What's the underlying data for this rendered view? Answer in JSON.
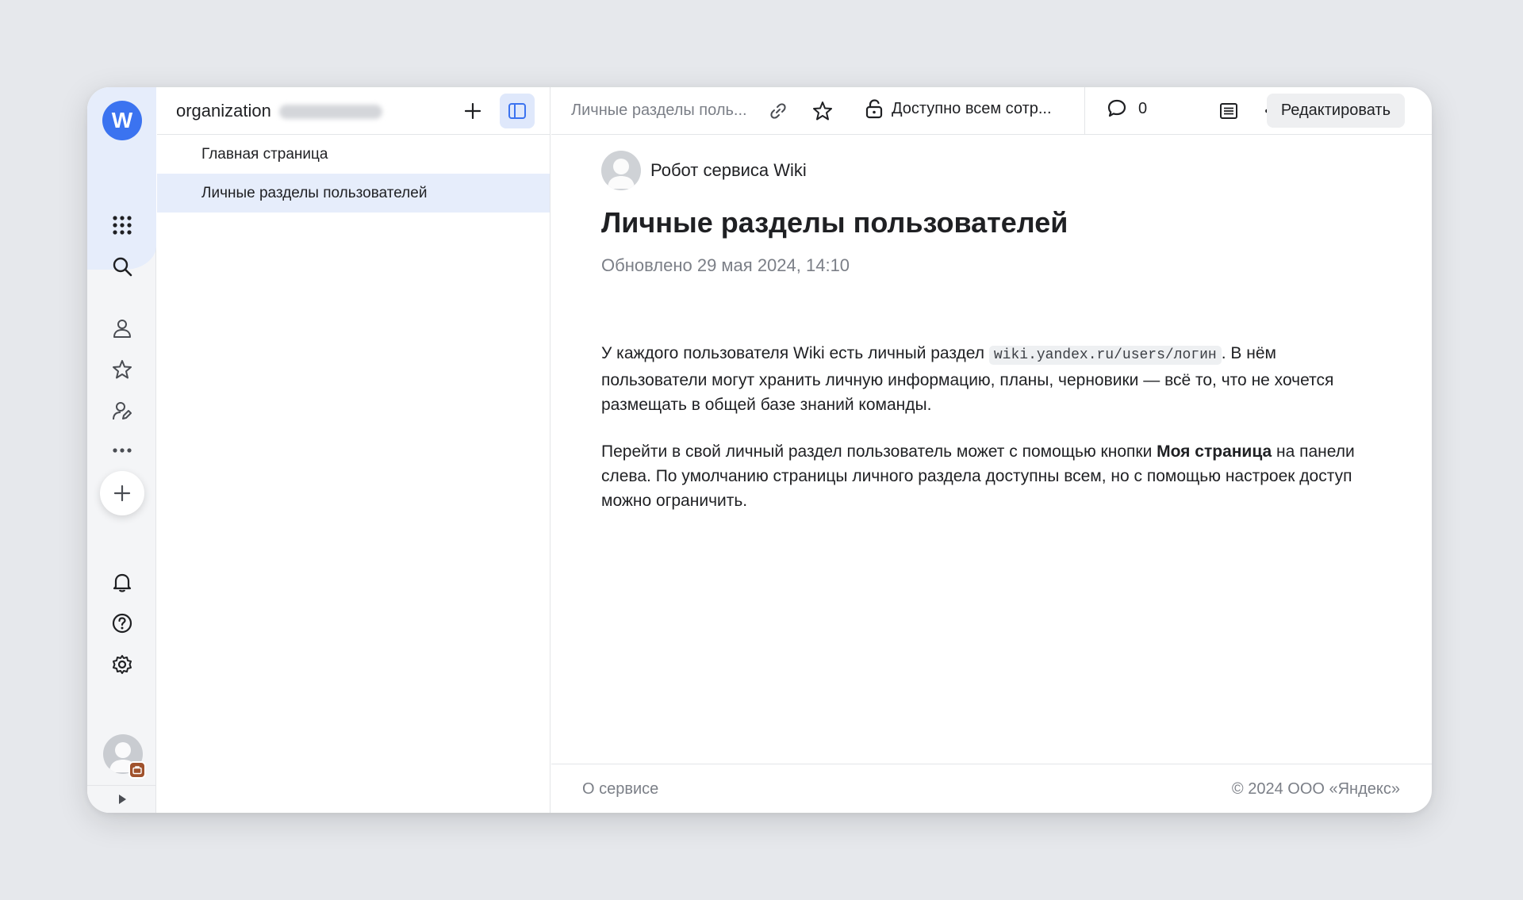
{
  "rail": {
    "logo_letter": "W",
    "icons": [
      "apps-icon",
      "search-icon",
      "user-icon",
      "star-icon",
      "user-edit-icon",
      "more-icon",
      "plus-icon",
      "bell-icon",
      "help-icon",
      "gear-icon"
    ]
  },
  "nav": {
    "org_label": "organization",
    "items": [
      {
        "label": "Главная страница",
        "active": false
      },
      {
        "label": "Личные разделы пользователей",
        "active": true
      }
    ]
  },
  "topbar": {
    "breadcrumb": "Личные разделы поль...",
    "access_label": "Доступно всем сотр...",
    "comments_count": "0",
    "edit_label": "Редактировать"
  },
  "page": {
    "author": "Робот сервиса Wiki",
    "title": "Личные разделы пользователей",
    "updated": "Обновлено 29 мая 2024,  14:10",
    "p1_before": "У каждого пользователя Wiki есть личный раздел ",
    "p1_code": "wiki.yandex.ru/users/логин",
    "p1_after": ". В нём пользователи могут хранить личную информацию, планы, черновики — всё то, что не хочется размещать в общей базе знаний команды.",
    "p2_before": "Перейти в свой личный раздел пользователь может с помощью кнопки ",
    "p2_bold": "Моя страница",
    "p2_after": " на панели слева. По умолчанию страницы личного раздела доступны всем, но с помощью настроек доступ можно ограничить."
  },
  "footer": {
    "about": "О сервисе",
    "copyright": "© 2024 ООО «Яндекс»"
  },
  "colors": {
    "accent": "#3b73f0",
    "active_bg": "#e6edfb",
    "page_bg": "#e6e8ec"
  }
}
